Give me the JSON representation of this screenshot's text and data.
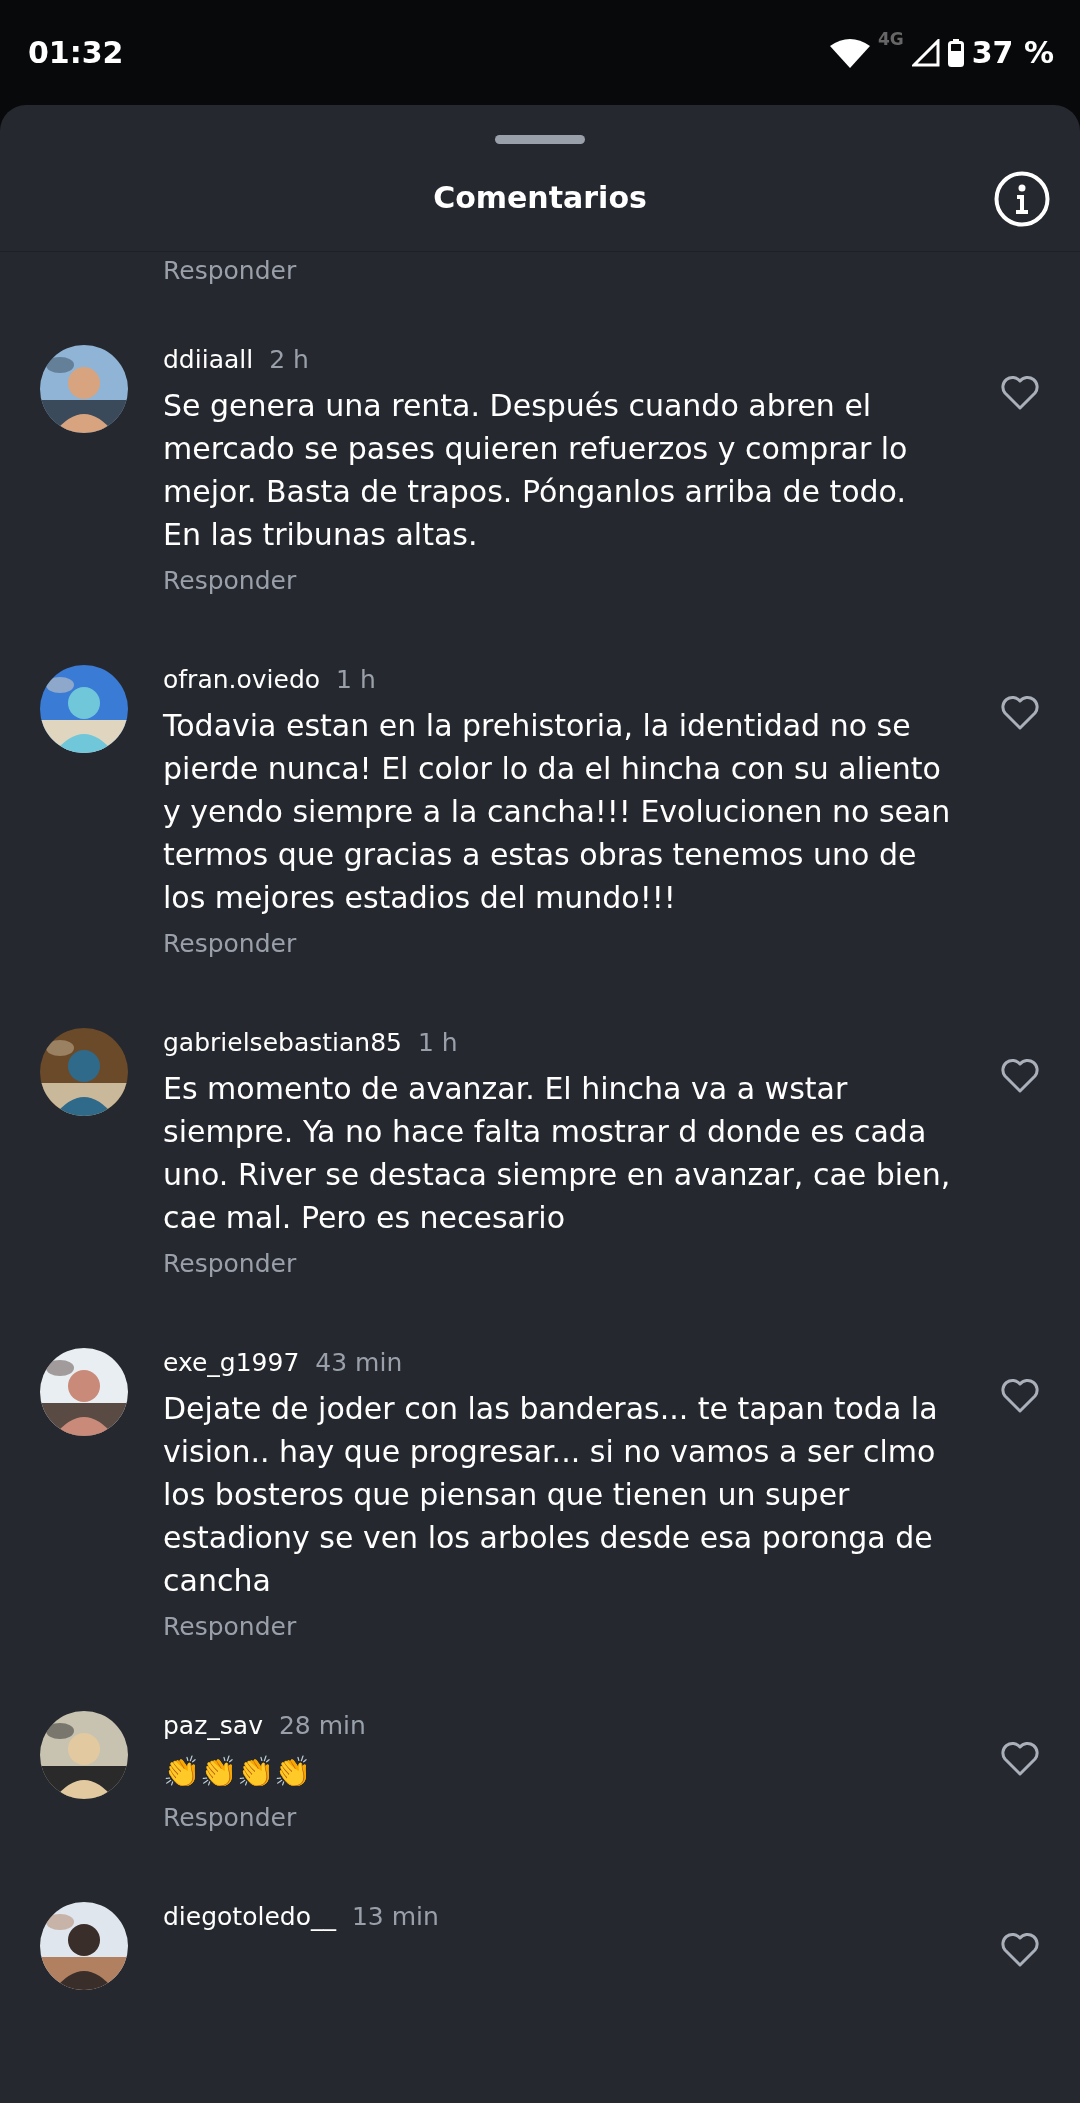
{
  "status_bar": {
    "time": "01:32",
    "network": "4G",
    "battery": "37 %"
  },
  "sheet": {
    "title": "Comentarios"
  },
  "top_reply": "Responder",
  "comments": [
    {
      "user": "ddiiaall",
      "time": "2 h",
      "text": "Se genera una renta. Después cuando abren el mercado se pases quieren refuerzos y comprar lo mejor.  Basta de trapos. Pónganlos arriba de todo. En las tribunas altas.",
      "reply": "Responder",
      "liked": false
    },
    {
      "user": "ofran.oviedo",
      "time": "1 h",
      "text": "Todavia estan en la prehistoria, la identidad no se pierde nunca! El color lo da el hincha con su aliento y yendo siempre a la cancha!!! Evolucionen no sean termos que gracias a estas obras tenemos uno de los mejores estadios del mundo!!!",
      "reply": "Responder",
      "liked": false
    },
    {
      "user": "gabrielsebastian85",
      "time": "1 h",
      "text": "Es momento de avanzar. El hincha va a wstar siempre. Ya no hace falta mostrar d donde es cada uno. River se destaca siempre en avanzar, cae bien, cae mal. Pero es necesario",
      "reply": "Responder",
      "liked": false
    },
    {
      "user": "exe_g1997",
      "time": "43 min",
      "text": "Dejate de joder con las banderas... te tapan toda la vision.. hay que progresar... si no vamos a ser clmo los bosteros que piensan que tienen un super estadiony se ven los arboles desde esa poronga de cancha",
      "reply": "Responder",
      "liked": false
    },
    {
      "user": "paz_sav",
      "time": "28 min",
      "text": "👏👏👏👏",
      "reply": "Responder",
      "liked": false
    },
    {
      "user": "diegotoledo__",
      "time": "13 min",
      "liked": false
    }
  ]
}
